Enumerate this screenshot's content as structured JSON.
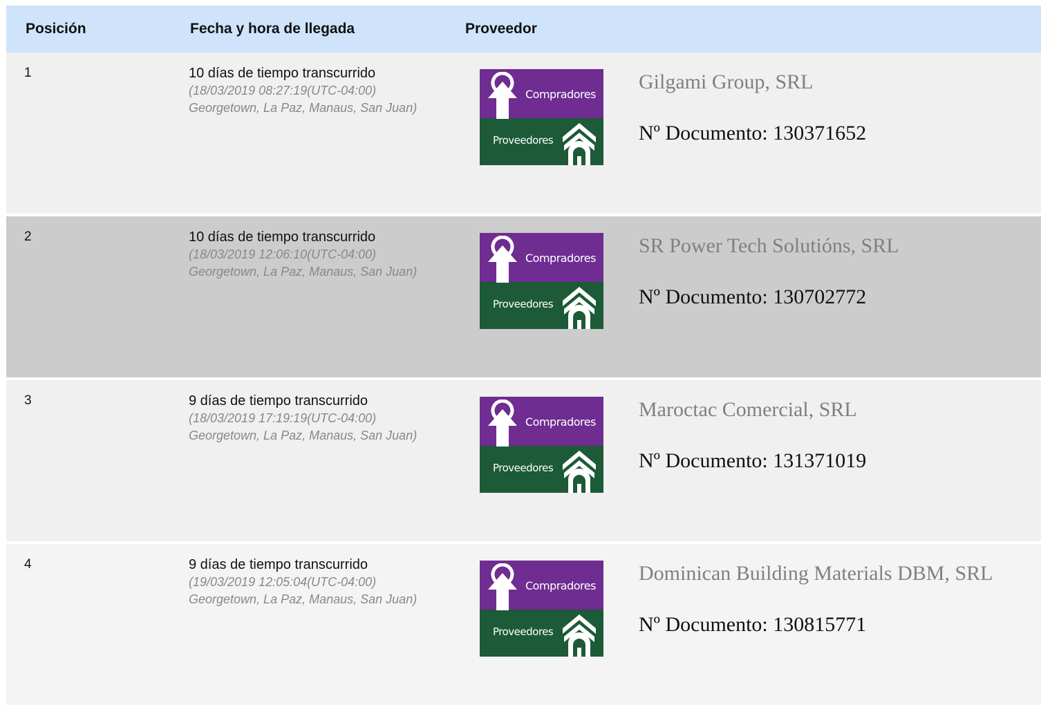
{
  "header": {
    "posicion": "Posición",
    "fecha": "Fecha y hora de llegada",
    "proveedor": "Proveedor"
  },
  "logo": {
    "compradores": "Compradores",
    "proveedores": "Proveedores",
    "colors": {
      "top": "#6f2c91",
      "bottom": "#1d5a37"
    }
  },
  "rows": [
    {
      "pos": "1",
      "elapsed": "10 días de tiempo transcurrido",
      "timestamp": "(18/03/2019 08:27:19(UTC-04:00) Georgetown, La Paz, Manaus, San Juan)",
      "name": "Gilgami Group, SRL",
      "doc": "Nº Documento: 130371652"
    },
    {
      "pos": "2",
      "elapsed": "10 días de tiempo transcurrido",
      "timestamp": "(18/03/2019 12:06:10(UTC-04:00) Georgetown, La Paz, Manaus, San Juan)",
      "name": "SR Power Tech Solutións, SRL",
      "doc": "Nº Documento: 130702772"
    },
    {
      "pos": "3",
      "elapsed": "9 días de tiempo transcurrido",
      "timestamp": "(18/03/2019 17:19:19(UTC-04:00) Georgetown, La Paz, Manaus, San Juan)",
      "name": "Maroctac Comercial, SRL",
      "doc": "Nº Documento: 131371019"
    },
    {
      "pos": "4",
      "elapsed": "9 días de tiempo transcurrido",
      "timestamp": "(19/03/2019 12:05:04(UTC-04:00) Georgetown, La Paz, Manaus, San Juan)",
      "name": "Dominican Building Materials DBM, SRL",
      "doc": "Nº Documento: 130815771"
    }
  ]
}
